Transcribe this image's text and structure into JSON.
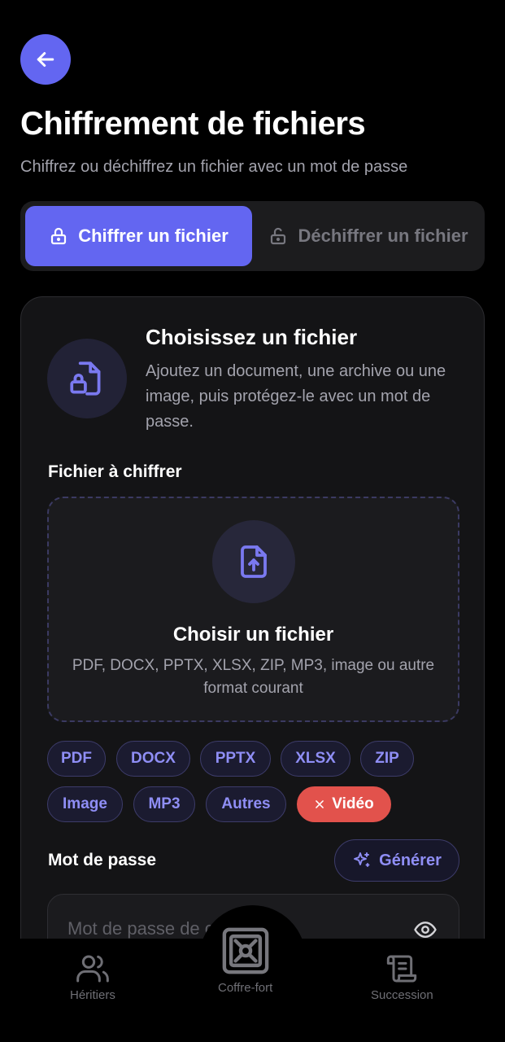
{
  "header": {
    "title": "Chiffrement de fichiers",
    "subtitle": "Chiffrez ou déchiffrez un fichier avec un mot de passe"
  },
  "segments": {
    "encrypt_label": "Chiffrer un fichier",
    "decrypt_label": "Déchiffrer un fichier",
    "active": "encrypt"
  },
  "card": {
    "title": "Choisissez un fichier",
    "description": "Ajoutez un document, une archive ou une image, puis protégez-le avec un mot de passe.",
    "file_label": "Fichier à chiffrer",
    "dropzone": {
      "title": "Choisir un fichier",
      "description": "PDF, DOCX, PPTX, XLSX, ZIP, MP3, image ou autre format courant"
    },
    "chips": [
      "PDF",
      "DOCX",
      "PPTX",
      "XLSX",
      "ZIP",
      "Image",
      "MP3",
      "Autres"
    ],
    "danger_chip": "Vidéo",
    "password_label": "Mot de passe",
    "generate_label": "Générer",
    "password_placeholder": "Mot de passe de chiffrement"
  },
  "tabbar": {
    "heirs": "Héritiers",
    "vault": "Coffre-fort",
    "succession": "Succession"
  },
  "colors": {
    "accent": "#6366f1",
    "danger": "#e2524c",
    "chip_text": "#8f8ef5"
  }
}
